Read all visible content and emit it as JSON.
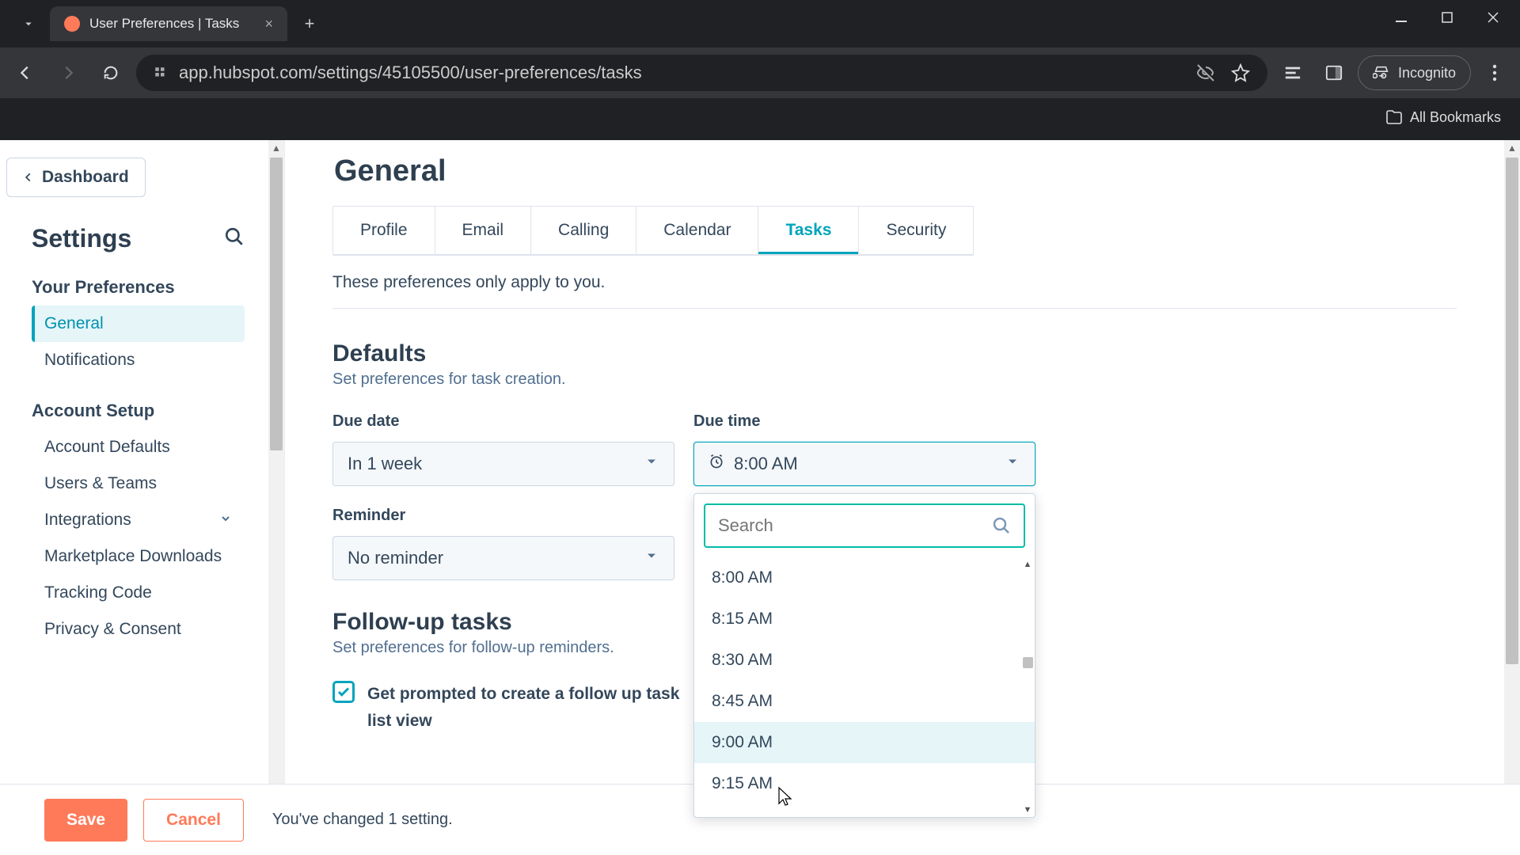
{
  "browser": {
    "tab_title": "User Preferences | Tasks",
    "url": "app.hubspot.com/settings/45105500/user-preferences/tasks",
    "incognito_label": "Incognito",
    "all_bookmarks": "All Bookmarks"
  },
  "sidebar": {
    "back_label": "Dashboard",
    "title": "Settings",
    "group1_title": "Your Preferences",
    "group1_items": [
      "General",
      "Notifications"
    ],
    "group2_title": "Account Setup",
    "group2_items": [
      "Account Defaults",
      "Users & Teams",
      "Integrations",
      "Marketplace Downloads",
      "Tracking Code",
      "Privacy & Consent"
    ]
  },
  "main": {
    "page_title": "General",
    "tabs": [
      "Profile",
      "Email",
      "Calling",
      "Calendar",
      "Tasks",
      "Security"
    ],
    "active_tab": 4,
    "intro": "These preferences only apply to you.",
    "defaults_title": "Defaults",
    "defaults_sub": "Set preferences for task creation.",
    "due_date_label": "Due date",
    "due_date_value": "In 1 week",
    "due_time_label": "Due time",
    "due_time_value": "8:00 AM",
    "reminder_label": "Reminder",
    "reminder_value": "No reminder",
    "dropdown_search_placeholder": "Search",
    "dropdown_options": [
      "8:00 AM",
      "8:15 AM",
      "8:30 AM",
      "8:45 AM",
      "9:00 AM",
      "9:15 AM"
    ],
    "followup_title": "Follow-up tasks",
    "followup_sub": "Set preferences for follow-up reminders.",
    "followup_checkbox_line1": "Get prompted to create a follow up task",
    "followup_checkbox_line2": "list view"
  },
  "footer": {
    "save": "Save",
    "cancel": "Cancel",
    "message": "You've changed 1 setting."
  }
}
